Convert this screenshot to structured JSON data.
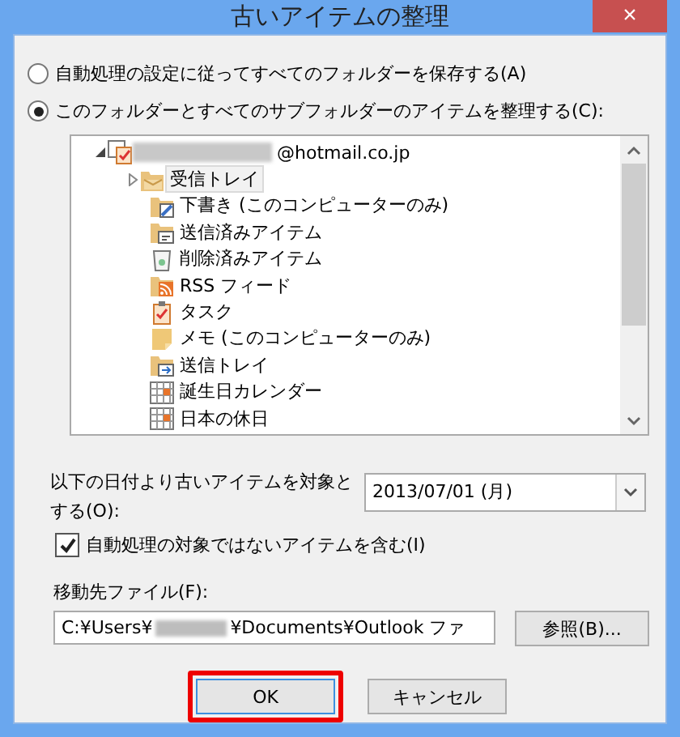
{
  "window": {
    "title": "古いアイテムの整理",
    "close": "×"
  },
  "options": [
    {
      "label": "自動処理の設定に従ってすべてのフォルダーを保存する(A)",
      "selected": false
    },
    {
      "label": "このフォルダーとすべてのサブフォルダーのアイテムを整理する(C):",
      "selected": true
    }
  ],
  "folder_tree": {
    "items": [
      {
        "label": "@hotmail.co.jp",
        "kind": "account",
        "expanded": true,
        "selected": false,
        "children": [
          {
            "label": "受信トレイ",
            "kind": "inbox",
            "expanded": false,
            "selected": true
          },
          {
            "label": "下書き (このコンピューターのみ)",
            "kind": "drafts",
            "selected": false
          },
          {
            "label": "送信済みアイテム",
            "kind": "sent",
            "selected": false
          },
          {
            "label": "削除済みアイテム",
            "kind": "trash",
            "selected": false
          },
          {
            "label": "RSS フィード",
            "kind": "rss",
            "selected": false
          },
          {
            "label": "タスク",
            "kind": "tasks",
            "selected": false
          },
          {
            "label": "メモ (このコンピューターのみ)",
            "kind": "notes",
            "selected": false
          },
          {
            "label": "送信トレイ",
            "kind": "outbox",
            "selected": false
          },
          {
            "label": "誕生日カレンダー",
            "kind": "calendar",
            "selected": false
          },
          {
            "label": "日本の休日",
            "kind": "calendar",
            "selected": false
          }
        ]
      }
    ]
  },
  "date_filter": {
    "label": "以下の日付より古いアイテムを対象とする(O):",
    "value": "2013/07/01 (月)"
  },
  "include_option": {
    "label": "自動処理の対象ではないアイテムを含む(I)",
    "checked": true
  },
  "target_file": {
    "label": "移動先ファイル(F):",
    "value_start": "C:¥Users¥",
    "value_end": "¥Documents¥Outlook ファ",
    "browse": "参照(B)..."
  },
  "buttons": [
    {
      "label": "OK",
      "highlighted": true
    },
    {
      "label": "キャンセル",
      "highlighted": false
    }
  ]
}
